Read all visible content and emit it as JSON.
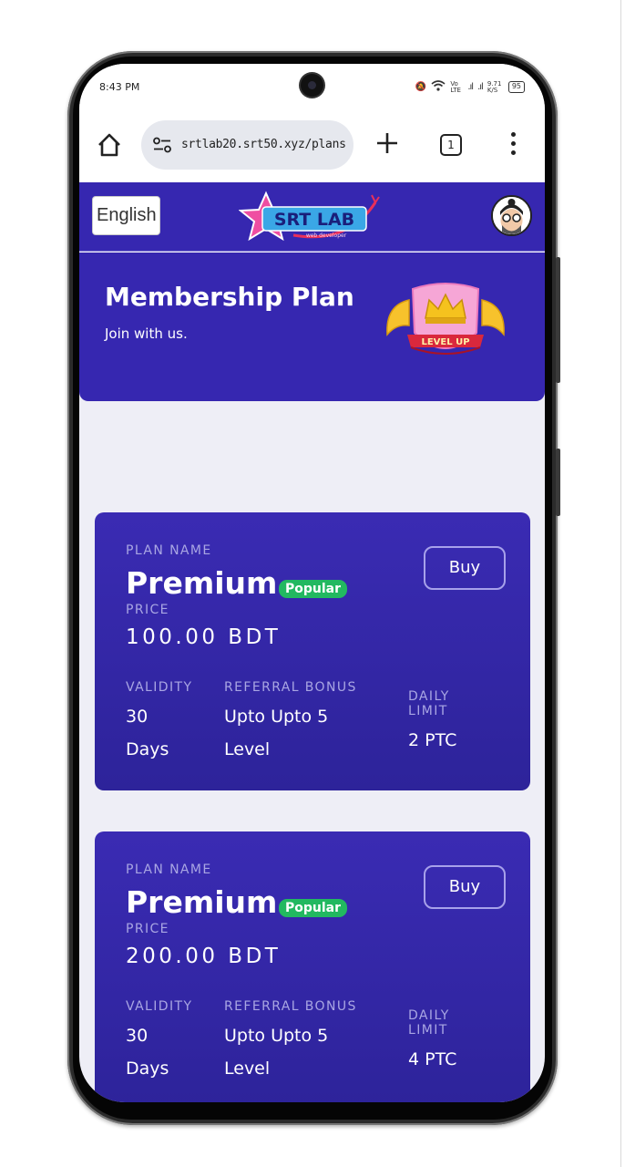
{
  "status_bar": {
    "time": "8:43 PM",
    "network": "Vo LTE",
    "speed": "9.71 K/S",
    "battery": "95"
  },
  "browser": {
    "url": "srtlab20.srt50.xyz/plans",
    "tab_count": "1"
  },
  "header": {
    "language": "English",
    "logo_text": "SRT LAB",
    "logo_sub": "web developer"
  },
  "hero": {
    "title": "Membership Plan",
    "subtitle": "Join with us.",
    "badge_text": "LEVEL UP"
  },
  "labels": {
    "plan_name": "PLAN NAME",
    "price": "PRICE",
    "validity": "VALIDITY",
    "referral_bonus": "REFERRAL BONUS",
    "daily_limit_1": "DAILY",
    "daily_limit_2": "LIMIT",
    "buy": "Buy",
    "popular": "Popular"
  },
  "plans": [
    {
      "name": "Premium",
      "price": "100.00 BDT",
      "validity_1": "30",
      "validity_2": "Days",
      "referral_1": "Upto Upto 5",
      "referral_2": "Level",
      "daily_limit": "2 PTC"
    },
    {
      "name": "Premium",
      "price": "200.00 BDT",
      "validity_1": "30",
      "validity_2": "Days",
      "referral_1": "Upto Upto 5",
      "referral_2": "Level",
      "daily_limit": "4 PTC"
    }
  ],
  "colors": {
    "brand": "#3627b0",
    "card_top": "#3a2bb3",
    "card_bottom": "#2d239a",
    "badge_green": "#22b860",
    "label_muted": "#a9a6e3"
  }
}
